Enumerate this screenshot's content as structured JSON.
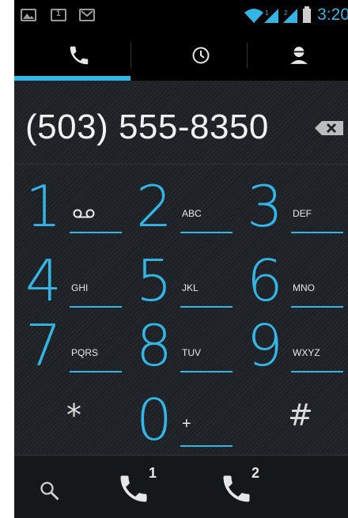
{
  "status_bar": {
    "clock": "3:20",
    "accent": "#33b5e5",
    "notifications": [
      "gallery-icon",
      "calendar-icon",
      "gmail-icon"
    ],
    "indicators": [
      "wifi-icon",
      "signal-1-icon",
      "signal-2-icon",
      "battery-icon"
    ],
    "calendar_day": "1"
  },
  "tabs": {
    "items": [
      {
        "name": "phone",
        "icon": "phone-icon",
        "selected": true
      },
      {
        "name": "call-log",
        "icon": "clock-icon",
        "selected": false
      },
      {
        "name": "contacts",
        "icon": "person-icon",
        "selected": false
      }
    ]
  },
  "dialer": {
    "number": "(503) 555-8350",
    "delete_icon": "backspace-icon",
    "voicemail_icon": "voicemail-icon",
    "keys": [
      {
        "digit": "1",
        "letters": ""
      },
      {
        "digit": "2",
        "letters": "ABC"
      },
      {
        "digit": "3",
        "letters": "DEF"
      },
      {
        "digit": "4",
        "letters": "GHI"
      },
      {
        "digit": "5",
        "letters": "JKL"
      },
      {
        "digit": "6",
        "letters": "MNO"
      },
      {
        "digit": "7",
        "letters": "PQRS"
      },
      {
        "digit": "8",
        "letters": "TUV"
      },
      {
        "digit": "9",
        "letters": "WXYZ"
      },
      {
        "digit": "*",
        "letters": ""
      },
      {
        "digit": "0",
        "letters": "+"
      },
      {
        "digit": "#",
        "letters": ""
      }
    ]
  },
  "bottom_bar": {
    "search_icon": "search-icon",
    "call_sim1": "1",
    "call_sim2": "2"
  }
}
